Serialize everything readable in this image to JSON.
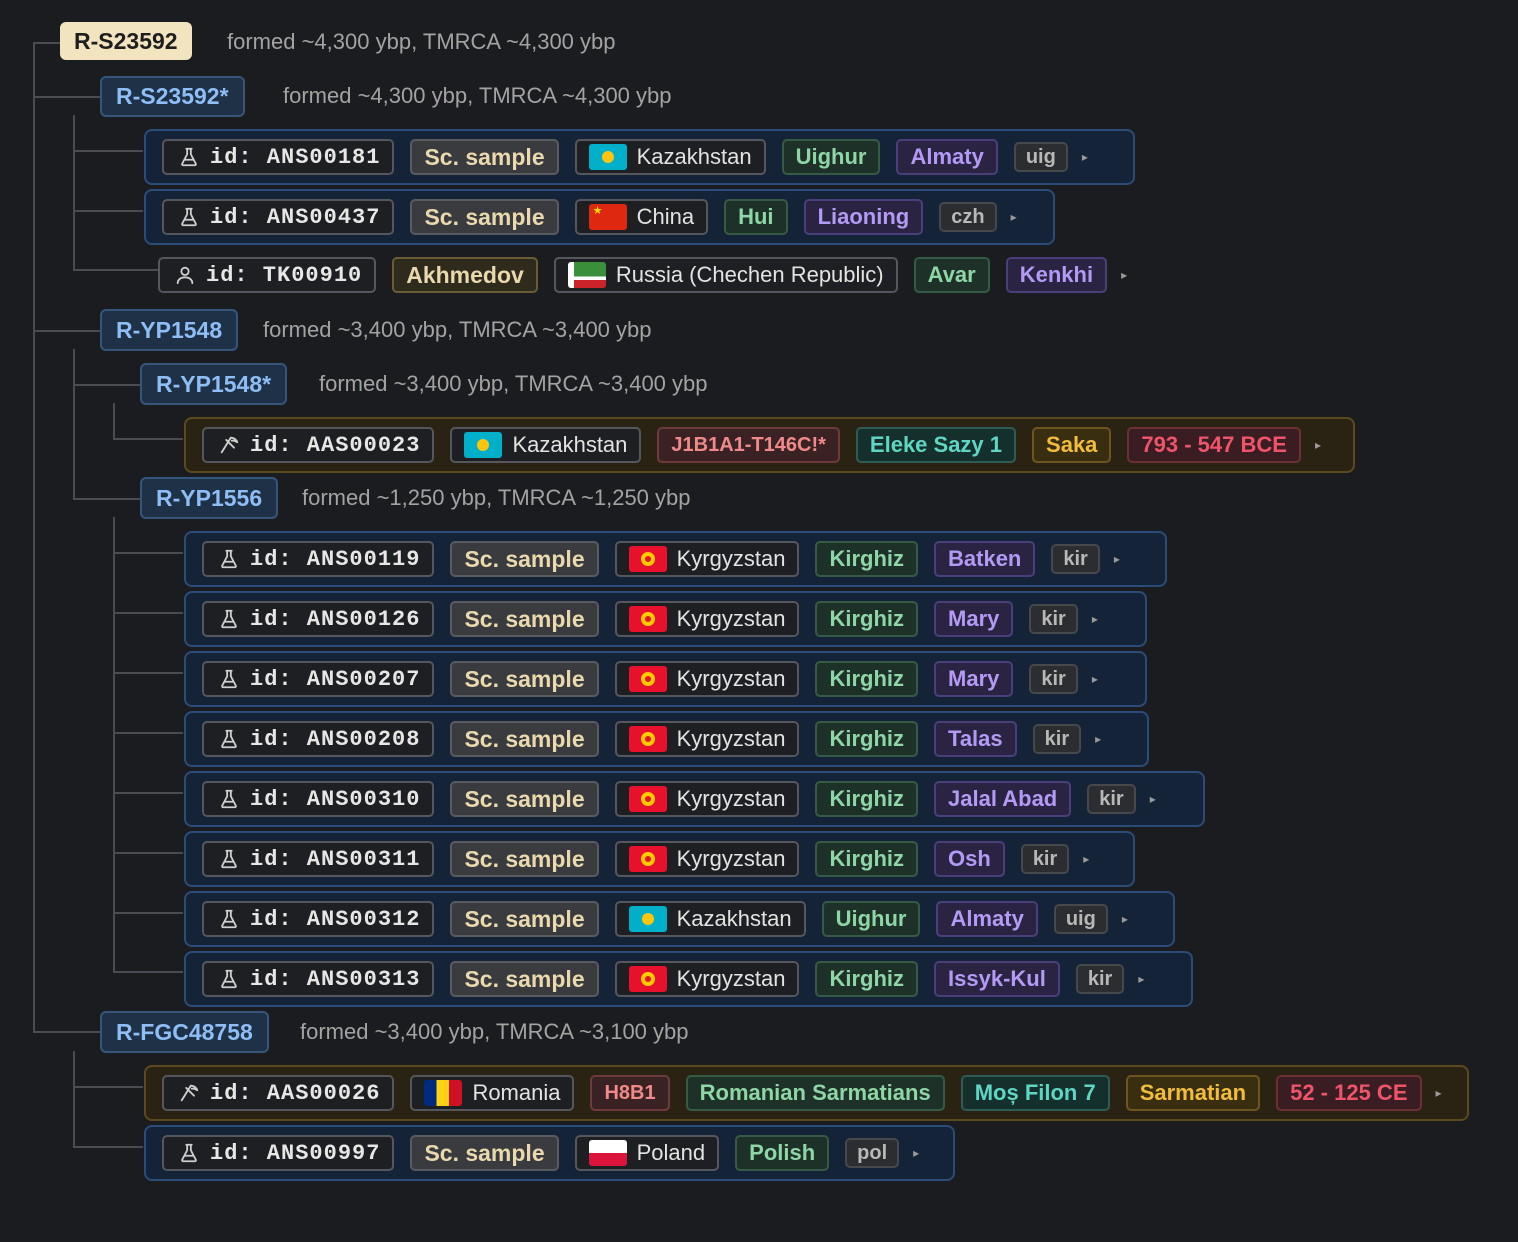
{
  "root": {
    "label": "R-S23592",
    "meta": "formed ~4,300 ybp, TMRCA ~4,300 ybp"
  },
  "clades": {
    "s23592star": {
      "label": "R-S23592*",
      "meta": "formed ~4,300 ybp, TMRCA ~4,300 ybp"
    },
    "yp1548": {
      "label": "R-YP1548",
      "meta": "formed ~3,400 ybp, TMRCA ~3,400 ybp"
    },
    "yp1548star": {
      "label": "R-YP1548*",
      "meta": "formed ~3,400 ybp, TMRCA ~3,400 ybp"
    },
    "yp1556": {
      "label": "R-YP1556",
      "meta": "formed ~1,250 ybp, TMRCA ~1,250 ybp"
    },
    "fgc48758": {
      "label": "R-FGC48758",
      "meta": "formed ~3,400 ybp, TMRCA ~3,100 ybp"
    }
  },
  "samples": [
    {
      "id": "id: ANS00181",
      "type": "Sc. sample",
      "country": "Kazakhstan",
      "ethnicity": "Uighur",
      "location": "Almaty",
      "lang": "uig",
      "flag": "kz",
      "icon": "flask-icon"
    },
    {
      "id": "id: ANS00437",
      "type": "Sc. sample",
      "country": "China",
      "ethnicity": "Hui",
      "location": "Liaoning",
      "lang": "czh",
      "flag": "cn",
      "icon": "flask-icon"
    },
    {
      "id": "id: TK00910",
      "name": "Akhmedov",
      "country": "Russia (Chechen Republic)",
      "ethnicity": "Avar",
      "location": "Kenkhi",
      "flag": "chechnya",
      "icon": "person-icon"
    },
    {
      "id": "id: AAS00023",
      "country": "Kazakhstan",
      "haplogroup": "J1B1A1-T146C!*",
      "site": "Eleke Sazy 1",
      "culture": "Saka",
      "date": "793 - 547 BCE",
      "flag": "kz",
      "icon": "pickaxe-icon"
    },
    {
      "id": "id: ANS00119",
      "type": "Sc. sample",
      "country": "Kyrgyzstan",
      "ethnicity": "Kirghiz",
      "location": "Batken",
      "lang": "kir",
      "flag": "kg",
      "icon": "flask-icon"
    },
    {
      "id": "id: ANS00126",
      "type": "Sc. sample",
      "country": "Kyrgyzstan",
      "ethnicity": "Kirghiz",
      "location": "Mary",
      "lang": "kir",
      "flag": "kg",
      "icon": "flask-icon"
    },
    {
      "id": "id: ANS00207",
      "type": "Sc. sample",
      "country": "Kyrgyzstan",
      "ethnicity": "Kirghiz",
      "location": "Mary",
      "lang": "kir",
      "flag": "kg",
      "icon": "flask-icon"
    },
    {
      "id": "id: ANS00208",
      "type": "Sc. sample",
      "country": "Kyrgyzstan",
      "ethnicity": "Kirghiz",
      "location": "Talas",
      "lang": "kir",
      "flag": "kg",
      "icon": "flask-icon"
    },
    {
      "id": "id: ANS00310",
      "type": "Sc. sample",
      "country": "Kyrgyzstan",
      "ethnicity": "Kirghiz",
      "location": "Jalal Abad",
      "lang": "kir",
      "flag": "kg",
      "icon": "flask-icon"
    },
    {
      "id": "id: ANS00311",
      "type": "Sc. sample",
      "country": "Kyrgyzstan",
      "ethnicity": "Kirghiz",
      "location": "Osh",
      "lang": "kir",
      "flag": "kg",
      "icon": "flask-icon"
    },
    {
      "id": "id: ANS00312",
      "type": "Sc. sample",
      "country": "Kazakhstan",
      "ethnicity": "Uighur",
      "location": "Almaty",
      "lang": "uig",
      "flag": "kz",
      "icon": "flask-icon"
    },
    {
      "id": "id: ANS00313",
      "type": "Sc. sample",
      "country": "Kyrgyzstan",
      "ethnicity": "Kirghiz",
      "location": "Issyk-Kul",
      "lang": "kir",
      "flag": "kg",
      "icon": "flask-icon"
    },
    {
      "id": "id: AAS00026",
      "country": "Romania",
      "ethnicity": "Romanian Sarmatians",
      "haplogroup": "H8B1",
      "site": "Moș Filon 7",
      "culture": "Sarmatian",
      "date": "52 - 125 CE",
      "flag": "ro",
      "icon": "pickaxe-icon"
    },
    {
      "id": "id: ANS00997",
      "type": "Sc. sample",
      "country": "Poland",
      "ethnicity": "Polish",
      "lang": "pol",
      "flag": "pl",
      "icon": "flask-icon"
    }
  ],
  "expand_glyph": "▸",
  "colors": {
    "background": "#1b1c1f",
    "modern_card_border": "#2b4c78",
    "ancient_card_border": "#5c4a1f",
    "root_tag": "#f2e4bf",
    "clade_tag_text": "#8ebef5"
  }
}
